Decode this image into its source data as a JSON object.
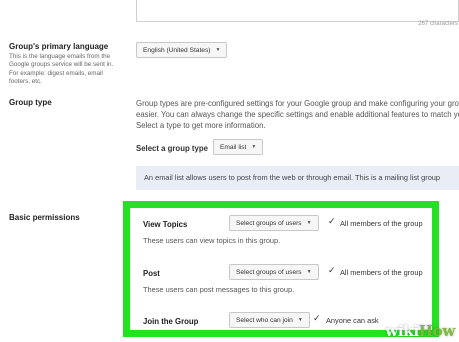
{
  "description_box": {
    "char_count": "267 characters"
  },
  "language": {
    "label": "Group's primary language",
    "description": "This is the language emails from the Google groups service will be sent in. For example: digest emails, email footers, etc.",
    "value": "English (United States)"
  },
  "group_type": {
    "label": "Group type",
    "description_lines": [
      "Group types are pre-configured settings for your Google group and make configuring your group",
      "easier. You can always change the specific settings and enable additional features to match your",
      "Select a type to get more information."
    ],
    "select_label": "Select a group type",
    "select_value": "Email list",
    "info": "An email list allows users to post from the web or through email. This is a mailing list group"
  },
  "permissions": {
    "label": "Basic permissions",
    "items": [
      {
        "title": "View Topics",
        "select": "Select groups of users",
        "value": "All members of the group",
        "description": "These users can view topics in this group."
      },
      {
        "title": "Post",
        "select": "Select groups of users",
        "value": "All members of the group",
        "description": "These users can post messages to this group."
      },
      {
        "title": "Join the Group",
        "select": "Select who can join",
        "value": "Anyone can ask",
        "description": ""
      }
    ]
  },
  "watermark": {
    "wiki": "wiki",
    "how": "How"
  },
  "colors": {
    "highlight": "#26e023",
    "info_bg": "#e8edf6",
    "brand_green": "#7fbb3a"
  },
  "icons": {
    "dropdown": "caret-down-icon",
    "check": "checkmark-icon"
  }
}
